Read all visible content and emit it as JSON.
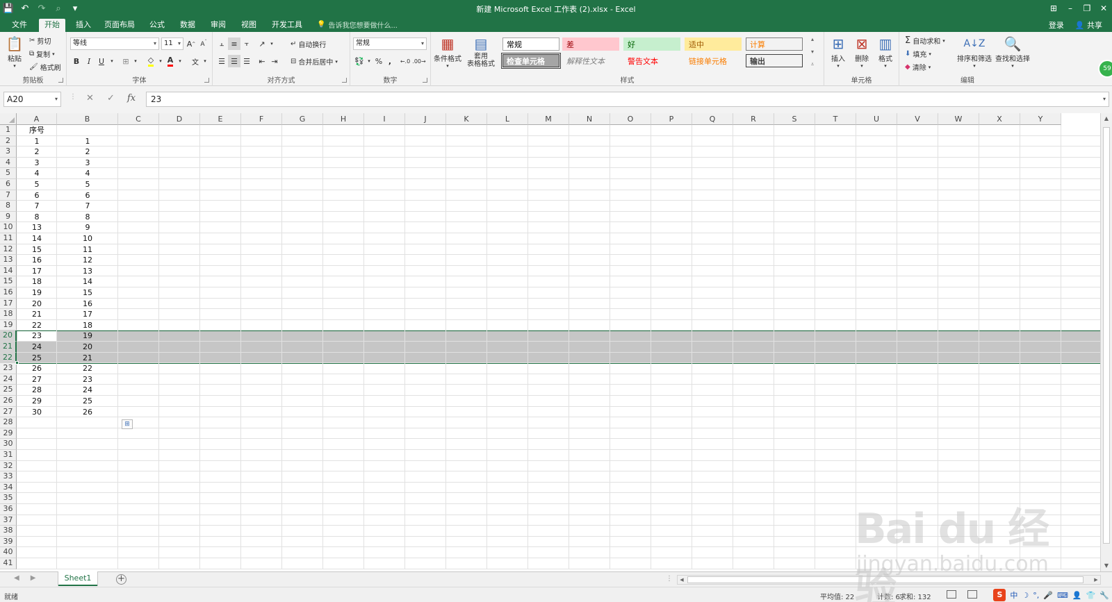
{
  "window": {
    "title": "新建 Microsoft Excel 工作表 (2).xlsx - Excel",
    "controls": [
      "⊞",
      "–",
      "❐",
      "✕"
    ]
  },
  "ribbon_tabs": [
    "文件",
    "开始",
    "插入",
    "页面布局",
    "公式",
    "数据",
    "审阅",
    "视图",
    "开发工具"
  ],
  "active_tab": "开始",
  "tell_me": "告诉我您想要做什么...",
  "account": {
    "signin": "登录",
    "share": "共享"
  },
  "clipboard": {
    "paste": "粘贴",
    "cut": "剪切",
    "copy": "复制",
    "format_painter": "格式刷",
    "label": "剪贴板"
  },
  "font": {
    "name": "等线",
    "size": "11",
    "bold": "B",
    "italic": "I",
    "underline": "U",
    "label": "字体"
  },
  "alignment": {
    "wrap_text": "自动换行",
    "merge_center": "合并后居中",
    "label": "对齐方式"
  },
  "number": {
    "format": "常规",
    "percent": "%",
    "comma": ",",
    "label": "数字"
  },
  "styles": {
    "conditional_format": "条件格式",
    "format_as_table": "套用\n表格格式",
    "cells": [
      {
        "name": "常规",
        "color": "#000000",
        "bg": "#ffffff",
        "border": "#a6a6a6"
      },
      {
        "name": "差",
        "color": "#9c0006",
        "bg": "#ffc7ce",
        "border": "#ffc7ce"
      },
      {
        "name": "好",
        "color": "#006100",
        "bg": "#c6efce",
        "border": "#c6efce"
      },
      {
        "name": "适中",
        "color": "#9c5700",
        "bg": "#ffeb9c",
        "border": "#ffeb9c"
      },
      {
        "name": "计算",
        "color": "#fa7d00",
        "bg": "#f2f2f2",
        "border": "#7f7f7f"
      },
      {
        "name": "检查单元格",
        "color": "#ffffff",
        "bg": "#a5a5a5",
        "border": "#3f3f3f"
      },
      {
        "name": "解释性文本",
        "color": "#7f7f7f",
        "bg": "#f3f3f3",
        "border": "#f3f3f3"
      },
      {
        "name": "警告文本",
        "color": "#ff0000",
        "bg": "#f3f3f3",
        "border": "#f3f3f3"
      },
      {
        "name": "链接单元格",
        "color": "#fa7d00",
        "bg": "#f3f3f3",
        "border": "#f3f3f3"
      },
      {
        "name": "输出",
        "color": "#3f3f3f",
        "bg": "#f2f2f2",
        "border": "#3f3f3f"
      }
    ],
    "label": "样式"
  },
  "cells_group": {
    "insert": "插入",
    "delete": "删除",
    "format": "格式",
    "label": "单元格"
  },
  "editing": {
    "autosum": "自动求和",
    "fill": "填充",
    "clear": "清除",
    "sort_filter": "排序和筛选",
    "find_select": "查找和选择",
    "label": "编辑"
  },
  "formula_bar": {
    "name_box": "A20",
    "cancel": "✕",
    "enter": "✓",
    "fx": "fx",
    "value": "23"
  },
  "columns": [
    "A",
    "B",
    "C",
    "D",
    "E",
    "F",
    "G",
    "H",
    "I",
    "J",
    "K",
    "L",
    "M",
    "N",
    "O",
    "P",
    "Q",
    "R",
    "S",
    "T",
    "U",
    "V",
    "W",
    "X",
    "Y"
  ],
  "rows": [
    [
      "序号",
      ""
    ],
    [
      "1",
      "1"
    ],
    [
      "2",
      "2"
    ],
    [
      "3",
      "3"
    ],
    [
      "4",
      "4"
    ],
    [
      "5",
      "5"
    ],
    [
      "6",
      "6"
    ],
    [
      "7",
      "7"
    ],
    [
      "8",
      "8"
    ],
    [
      "13",
      "9"
    ],
    [
      "14",
      "10"
    ],
    [
      "15",
      "11"
    ],
    [
      "16",
      "12"
    ],
    [
      "17",
      "13"
    ],
    [
      "18",
      "14"
    ],
    [
      "19",
      "15"
    ],
    [
      "20",
      "16"
    ],
    [
      "21",
      "17"
    ],
    [
      "22",
      "18"
    ],
    [
      "23",
      "19"
    ],
    [
      "24",
      "20"
    ],
    [
      "25",
      "21"
    ],
    [
      "26",
      "22"
    ],
    [
      "27",
      "23"
    ],
    [
      "28",
      "24"
    ],
    [
      "29",
      "25"
    ],
    [
      "30",
      "26"
    ]
  ],
  "total_rows": 41,
  "selected_rows": [
    20,
    21,
    22
  ],
  "sheet": {
    "name": "Sheet1"
  },
  "status": {
    "ready": "就绪",
    "average": "平均值: 22",
    "count": "计数: 6",
    "sum": "求和: 132"
  },
  "ime": {
    "lang": "中",
    "s": "S"
  },
  "watermark": {
    "brand": "Bai du 经验",
    "url": "jingyan.baidu.com"
  },
  "avatar_badge": "59",
  "colors": {
    "accent": "#217346",
    "selection": "#c6c6c6"
  }
}
